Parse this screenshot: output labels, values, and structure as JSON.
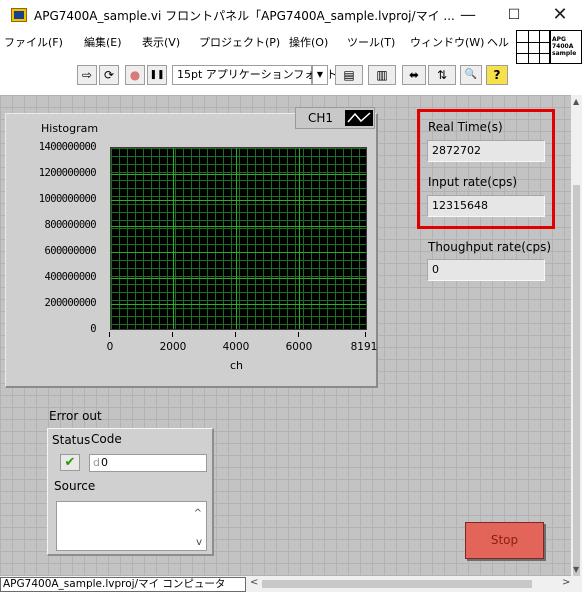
{
  "window": {
    "title": "APG7400A_sample.vi フロントパネル「APG7400A_sample.lvproj/マイ ...",
    "minimize": "—",
    "maximize": "☐",
    "close": "✕"
  },
  "menu": [
    "ファイル(F)",
    "編集(E)",
    "表示(V)",
    "プロジェクト(P)",
    "操作(O)",
    "ツール(T)",
    "ウィンドウ(W)",
    "ヘル"
  ],
  "vi_icon_text": "APG 7400A sample",
  "toolbar": {
    "run_arrow": "⇨",
    "run_continuous": "⟳",
    "abort": "●",
    "pause": "❚❚",
    "font": "15pt アプリケーションフォント",
    "font_arrow": "▼",
    "align": "▤",
    "distribute": "▥",
    "resize": "⬌",
    "reorder": "⇅",
    "search": "🔍",
    "help": "?"
  },
  "histogram": {
    "title": "Histogram",
    "legend_label": "CH1",
    "x_label": "ch",
    "y_ticks": [
      "1400000000",
      "1200000000",
      "1000000000",
      "800000000",
      "600000000",
      "400000000",
      "200000000",
      "0"
    ],
    "x_ticks": [
      "0",
      "2000",
      "4000",
      "6000",
      "8191"
    ]
  },
  "chart_data": {
    "type": "line",
    "title": "Histogram",
    "xlabel": "ch",
    "ylabel": "",
    "series": [
      {
        "name": "CH1",
        "values": []
      }
    ],
    "xlim": [
      0,
      8191
    ],
    "ylim": [
      0,
      1400000000
    ],
    "grid": true
  },
  "indicators": {
    "real_time_label": "Real Time(s)",
    "real_time_value": "2872702",
    "input_rate_label": "Input rate(cps)",
    "input_rate_value": "12315648",
    "throughput_label": "Thoughput rate(cps)",
    "throughput_value": "0"
  },
  "error_out": {
    "title": "Error out",
    "status_label": "Status",
    "status_glyph": "✔",
    "code_label": "Code",
    "code_prefix": "d",
    "code_value": "0",
    "source_label": "Source",
    "source_value": "",
    "scroll_up": "^",
    "scroll_down": "v"
  },
  "stop_button": "Stop",
  "statusbar": {
    "path": "APG7400A_sample.lvproj/マイ コンピュータ",
    "scroll_left": "<",
    "scroll_right": ">"
  },
  "colors": {
    "highlight": "#e00000",
    "plot_bg": "#000000",
    "grid": "#2faa2f",
    "stop_button": "#e3655a"
  }
}
